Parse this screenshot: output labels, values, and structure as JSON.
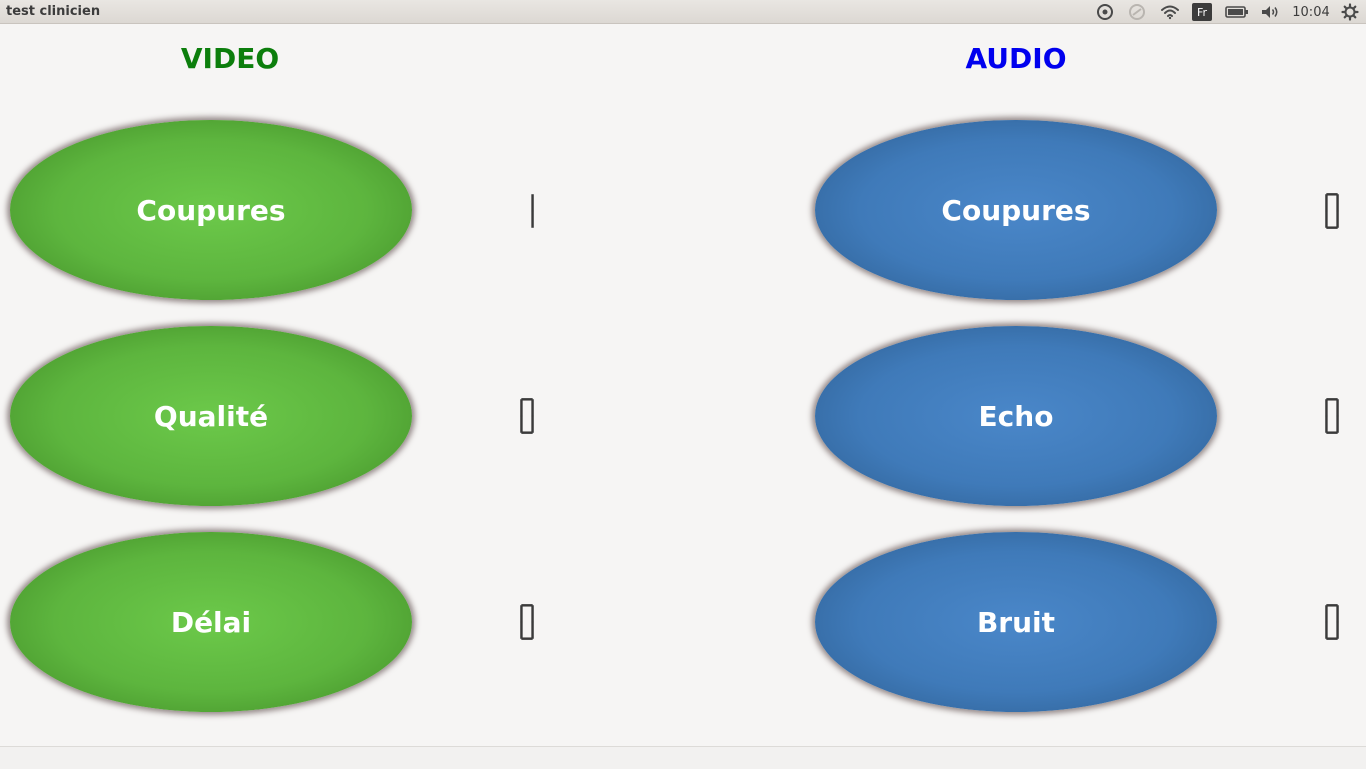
{
  "window": {
    "title": "test clinicien"
  },
  "tray": {
    "keyboard_layout": "Fr",
    "clock": "10:04",
    "icons": [
      "sync-icon",
      "network-off-icon",
      "wifi-icon",
      "keyboard-layout-icon",
      "battery-icon",
      "volume-icon",
      "settings-gear-icon"
    ]
  },
  "video": {
    "title": "VIDEO",
    "color": "#0c7e0c",
    "buttons": [
      {
        "label": "Coupures",
        "count": 1
      },
      {
        "label": "Qualité",
        "count": 0
      },
      {
        "label": "Délai",
        "count": 0
      }
    ]
  },
  "audio": {
    "title": "AUDIO",
    "color": "#0000ee",
    "buttons": [
      {
        "label": "Coupures",
        "count": 0
      },
      {
        "label": "Echo",
        "count": 0
      },
      {
        "label": "Bruit",
        "count": 0
      }
    ]
  }
}
